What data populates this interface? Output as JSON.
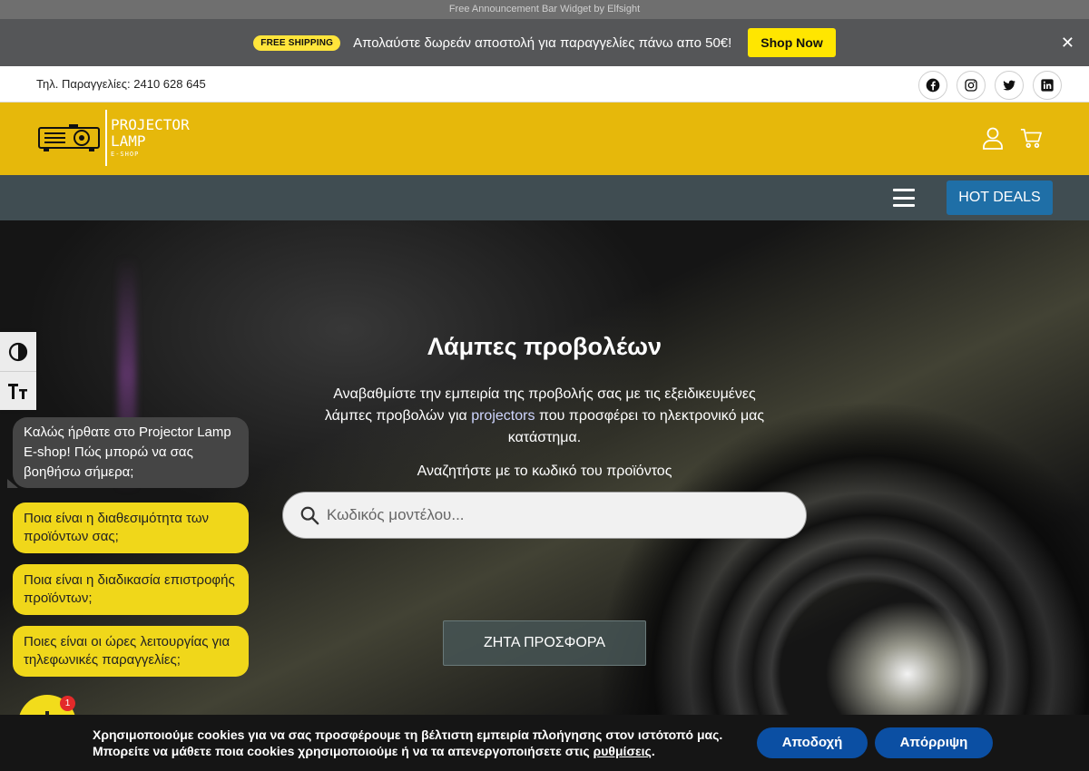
{
  "elfsight": {
    "text": "Free Announcement Bar Widget by Elfsight"
  },
  "announcement": {
    "badge": "FREE SHIPPING",
    "text": "Απολαύστε δωρεάν αποστολή για παραγγελίες πάνω απο 50€!",
    "button": "Shop Now",
    "close": "✕"
  },
  "contact": {
    "phone_label": "Τηλ. Παραγγελίες:",
    "phone": "2410 628 645",
    "socials": [
      "facebook-icon",
      "instagram-icon",
      "twitter-icon",
      "linkedin-icon"
    ]
  },
  "header": {
    "logo_line1": "PROJECTOR",
    "logo_line2": "LAMP",
    "logo_line3": "E-SHOP",
    "bg_color": "#e6b80b"
  },
  "nav": {
    "hot_deals": "HOT DEALS",
    "accent_color": "#1f6fa7"
  },
  "hero": {
    "title": "Λάμπες προβολέων",
    "subtitle_before": "Αναβαθμίστε την εμπειρία της προβολής σας με τις εξειδικευμένες λάμπες προβολών για ",
    "subtitle_link": "projectors",
    "subtitle_after": " που προσφέρει το ηλεκτρονικό μας κατάστημα.",
    "search_label": "Αναζητήστε με το κωδικό του προϊόντος",
    "search_placeholder": "Κωδικός μοντέλου...",
    "offer_button": "ΖΗΤΑ ΠΡΟΣΦΟΡΑ"
  },
  "chat": {
    "greeting": "Καλώς ήρθατε στο Projector Lamp E-shop! Πώς μπορώ να σας βοηθήσω σήμερα;",
    "options": [
      "Ποια είναι η διαθεσιμότητα των προϊόντων σας;",
      "Ποια είναι η διαδικασία επιστροφής προϊόντων;",
      "Ποιες είναι οι ώρες λειτουργίας για τηλεφωνικές παραγγελίες;"
    ],
    "badge_count": "1"
  },
  "cookies": {
    "line1": "Χρησιμοποιούμε cookies για να σας προσφέρουμε τη βέλτιστη εμπειρία πλοήγησης στον ιστότοπό μας.",
    "line2_before": "Μπορείτε να μάθετε ποια cookies χρησιμοποιούμε ή να τα απενεργοποιήσετε στις ",
    "line2_link": "ρυθμίσεις",
    "line2_after": ".",
    "accept": "Αποδοχή",
    "reject": "Απόρριψη"
  }
}
